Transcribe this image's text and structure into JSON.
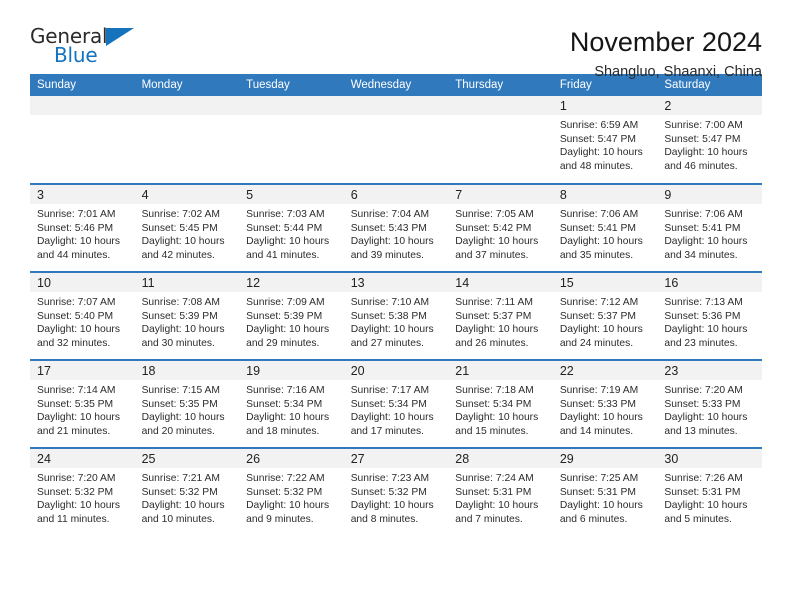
{
  "brand": {
    "name_part1": "General",
    "name_part2": "Blue",
    "accent_color": "#1573be"
  },
  "header": {
    "month_title": "November 2024",
    "location": "Shangluo, Shaanxi, China"
  },
  "calendar": {
    "header_color": "#3179bd",
    "weekday_headers": [
      "Sunday",
      "Monday",
      "Tuesday",
      "Wednesday",
      "Thursday",
      "Friday",
      "Saturday"
    ],
    "weeks": [
      [
        {
          "day": "",
          "lines": []
        },
        {
          "day": "",
          "lines": []
        },
        {
          "day": "",
          "lines": []
        },
        {
          "day": "",
          "lines": []
        },
        {
          "day": "",
          "lines": []
        },
        {
          "day": "1",
          "lines": [
            "Sunrise: 6:59 AM",
            "Sunset: 5:47 PM",
            "Daylight: 10 hours",
            "and 48 minutes."
          ]
        },
        {
          "day": "2",
          "lines": [
            "Sunrise: 7:00 AM",
            "Sunset: 5:47 PM",
            "Daylight: 10 hours",
            "and 46 minutes."
          ]
        }
      ],
      [
        {
          "day": "3",
          "lines": [
            "Sunrise: 7:01 AM",
            "Sunset: 5:46 PM",
            "Daylight: 10 hours",
            "and 44 minutes."
          ]
        },
        {
          "day": "4",
          "lines": [
            "Sunrise: 7:02 AM",
            "Sunset: 5:45 PM",
            "Daylight: 10 hours",
            "and 42 minutes."
          ]
        },
        {
          "day": "5",
          "lines": [
            "Sunrise: 7:03 AM",
            "Sunset: 5:44 PM",
            "Daylight: 10 hours",
            "and 41 minutes."
          ]
        },
        {
          "day": "6",
          "lines": [
            "Sunrise: 7:04 AM",
            "Sunset: 5:43 PM",
            "Daylight: 10 hours",
            "and 39 minutes."
          ]
        },
        {
          "day": "7",
          "lines": [
            "Sunrise: 7:05 AM",
            "Sunset: 5:42 PM",
            "Daylight: 10 hours",
            "and 37 minutes."
          ]
        },
        {
          "day": "8",
          "lines": [
            "Sunrise: 7:06 AM",
            "Sunset: 5:41 PM",
            "Daylight: 10 hours",
            "and 35 minutes."
          ]
        },
        {
          "day": "9",
          "lines": [
            "Sunrise: 7:06 AM",
            "Sunset: 5:41 PM",
            "Daylight: 10 hours",
            "and 34 minutes."
          ]
        }
      ],
      [
        {
          "day": "10",
          "lines": [
            "Sunrise: 7:07 AM",
            "Sunset: 5:40 PM",
            "Daylight: 10 hours",
            "and 32 minutes."
          ]
        },
        {
          "day": "11",
          "lines": [
            "Sunrise: 7:08 AM",
            "Sunset: 5:39 PM",
            "Daylight: 10 hours",
            "and 30 minutes."
          ]
        },
        {
          "day": "12",
          "lines": [
            "Sunrise: 7:09 AM",
            "Sunset: 5:39 PM",
            "Daylight: 10 hours",
            "and 29 minutes."
          ]
        },
        {
          "day": "13",
          "lines": [
            "Sunrise: 7:10 AM",
            "Sunset: 5:38 PM",
            "Daylight: 10 hours",
            "and 27 minutes."
          ]
        },
        {
          "day": "14",
          "lines": [
            "Sunrise: 7:11 AM",
            "Sunset: 5:37 PM",
            "Daylight: 10 hours",
            "and 26 minutes."
          ]
        },
        {
          "day": "15",
          "lines": [
            "Sunrise: 7:12 AM",
            "Sunset: 5:37 PM",
            "Daylight: 10 hours",
            "and 24 minutes."
          ]
        },
        {
          "day": "16",
          "lines": [
            "Sunrise: 7:13 AM",
            "Sunset: 5:36 PM",
            "Daylight: 10 hours",
            "and 23 minutes."
          ]
        }
      ],
      [
        {
          "day": "17",
          "lines": [
            "Sunrise: 7:14 AM",
            "Sunset: 5:35 PM",
            "Daylight: 10 hours",
            "and 21 minutes."
          ]
        },
        {
          "day": "18",
          "lines": [
            "Sunrise: 7:15 AM",
            "Sunset: 5:35 PM",
            "Daylight: 10 hours",
            "and 20 minutes."
          ]
        },
        {
          "day": "19",
          "lines": [
            "Sunrise: 7:16 AM",
            "Sunset: 5:34 PM",
            "Daylight: 10 hours",
            "and 18 minutes."
          ]
        },
        {
          "day": "20",
          "lines": [
            "Sunrise: 7:17 AM",
            "Sunset: 5:34 PM",
            "Daylight: 10 hours",
            "and 17 minutes."
          ]
        },
        {
          "day": "21",
          "lines": [
            "Sunrise: 7:18 AM",
            "Sunset: 5:34 PM",
            "Daylight: 10 hours",
            "and 15 minutes."
          ]
        },
        {
          "day": "22",
          "lines": [
            "Sunrise: 7:19 AM",
            "Sunset: 5:33 PM",
            "Daylight: 10 hours",
            "and 14 minutes."
          ]
        },
        {
          "day": "23",
          "lines": [
            "Sunrise: 7:20 AM",
            "Sunset: 5:33 PM",
            "Daylight: 10 hours",
            "and 13 minutes."
          ]
        }
      ],
      [
        {
          "day": "24",
          "lines": [
            "Sunrise: 7:20 AM",
            "Sunset: 5:32 PM",
            "Daylight: 10 hours",
            "and 11 minutes."
          ]
        },
        {
          "day": "25",
          "lines": [
            "Sunrise: 7:21 AM",
            "Sunset: 5:32 PM",
            "Daylight: 10 hours",
            "and 10 minutes."
          ]
        },
        {
          "day": "26",
          "lines": [
            "Sunrise: 7:22 AM",
            "Sunset: 5:32 PM",
            "Daylight: 10 hours",
            "and 9 minutes."
          ]
        },
        {
          "day": "27",
          "lines": [
            "Sunrise: 7:23 AM",
            "Sunset: 5:32 PM",
            "Daylight: 10 hours",
            "and 8 minutes."
          ]
        },
        {
          "day": "28",
          "lines": [
            "Sunrise: 7:24 AM",
            "Sunset: 5:31 PM",
            "Daylight: 10 hours",
            "and 7 minutes."
          ]
        },
        {
          "day": "29",
          "lines": [
            "Sunrise: 7:25 AM",
            "Sunset: 5:31 PM",
            "Daylight: 10 hours",
            "and 6 minutes."
          ]
        },
        {
          "day": "30",
          "lines": [
            "Sunrise: 7:26 AM",
            "Sunset: 5:31 PM",
            "Daylight: 10 hours",
            "and 5 minutes."
          ]
        }
      ]
    ]
  }
}
